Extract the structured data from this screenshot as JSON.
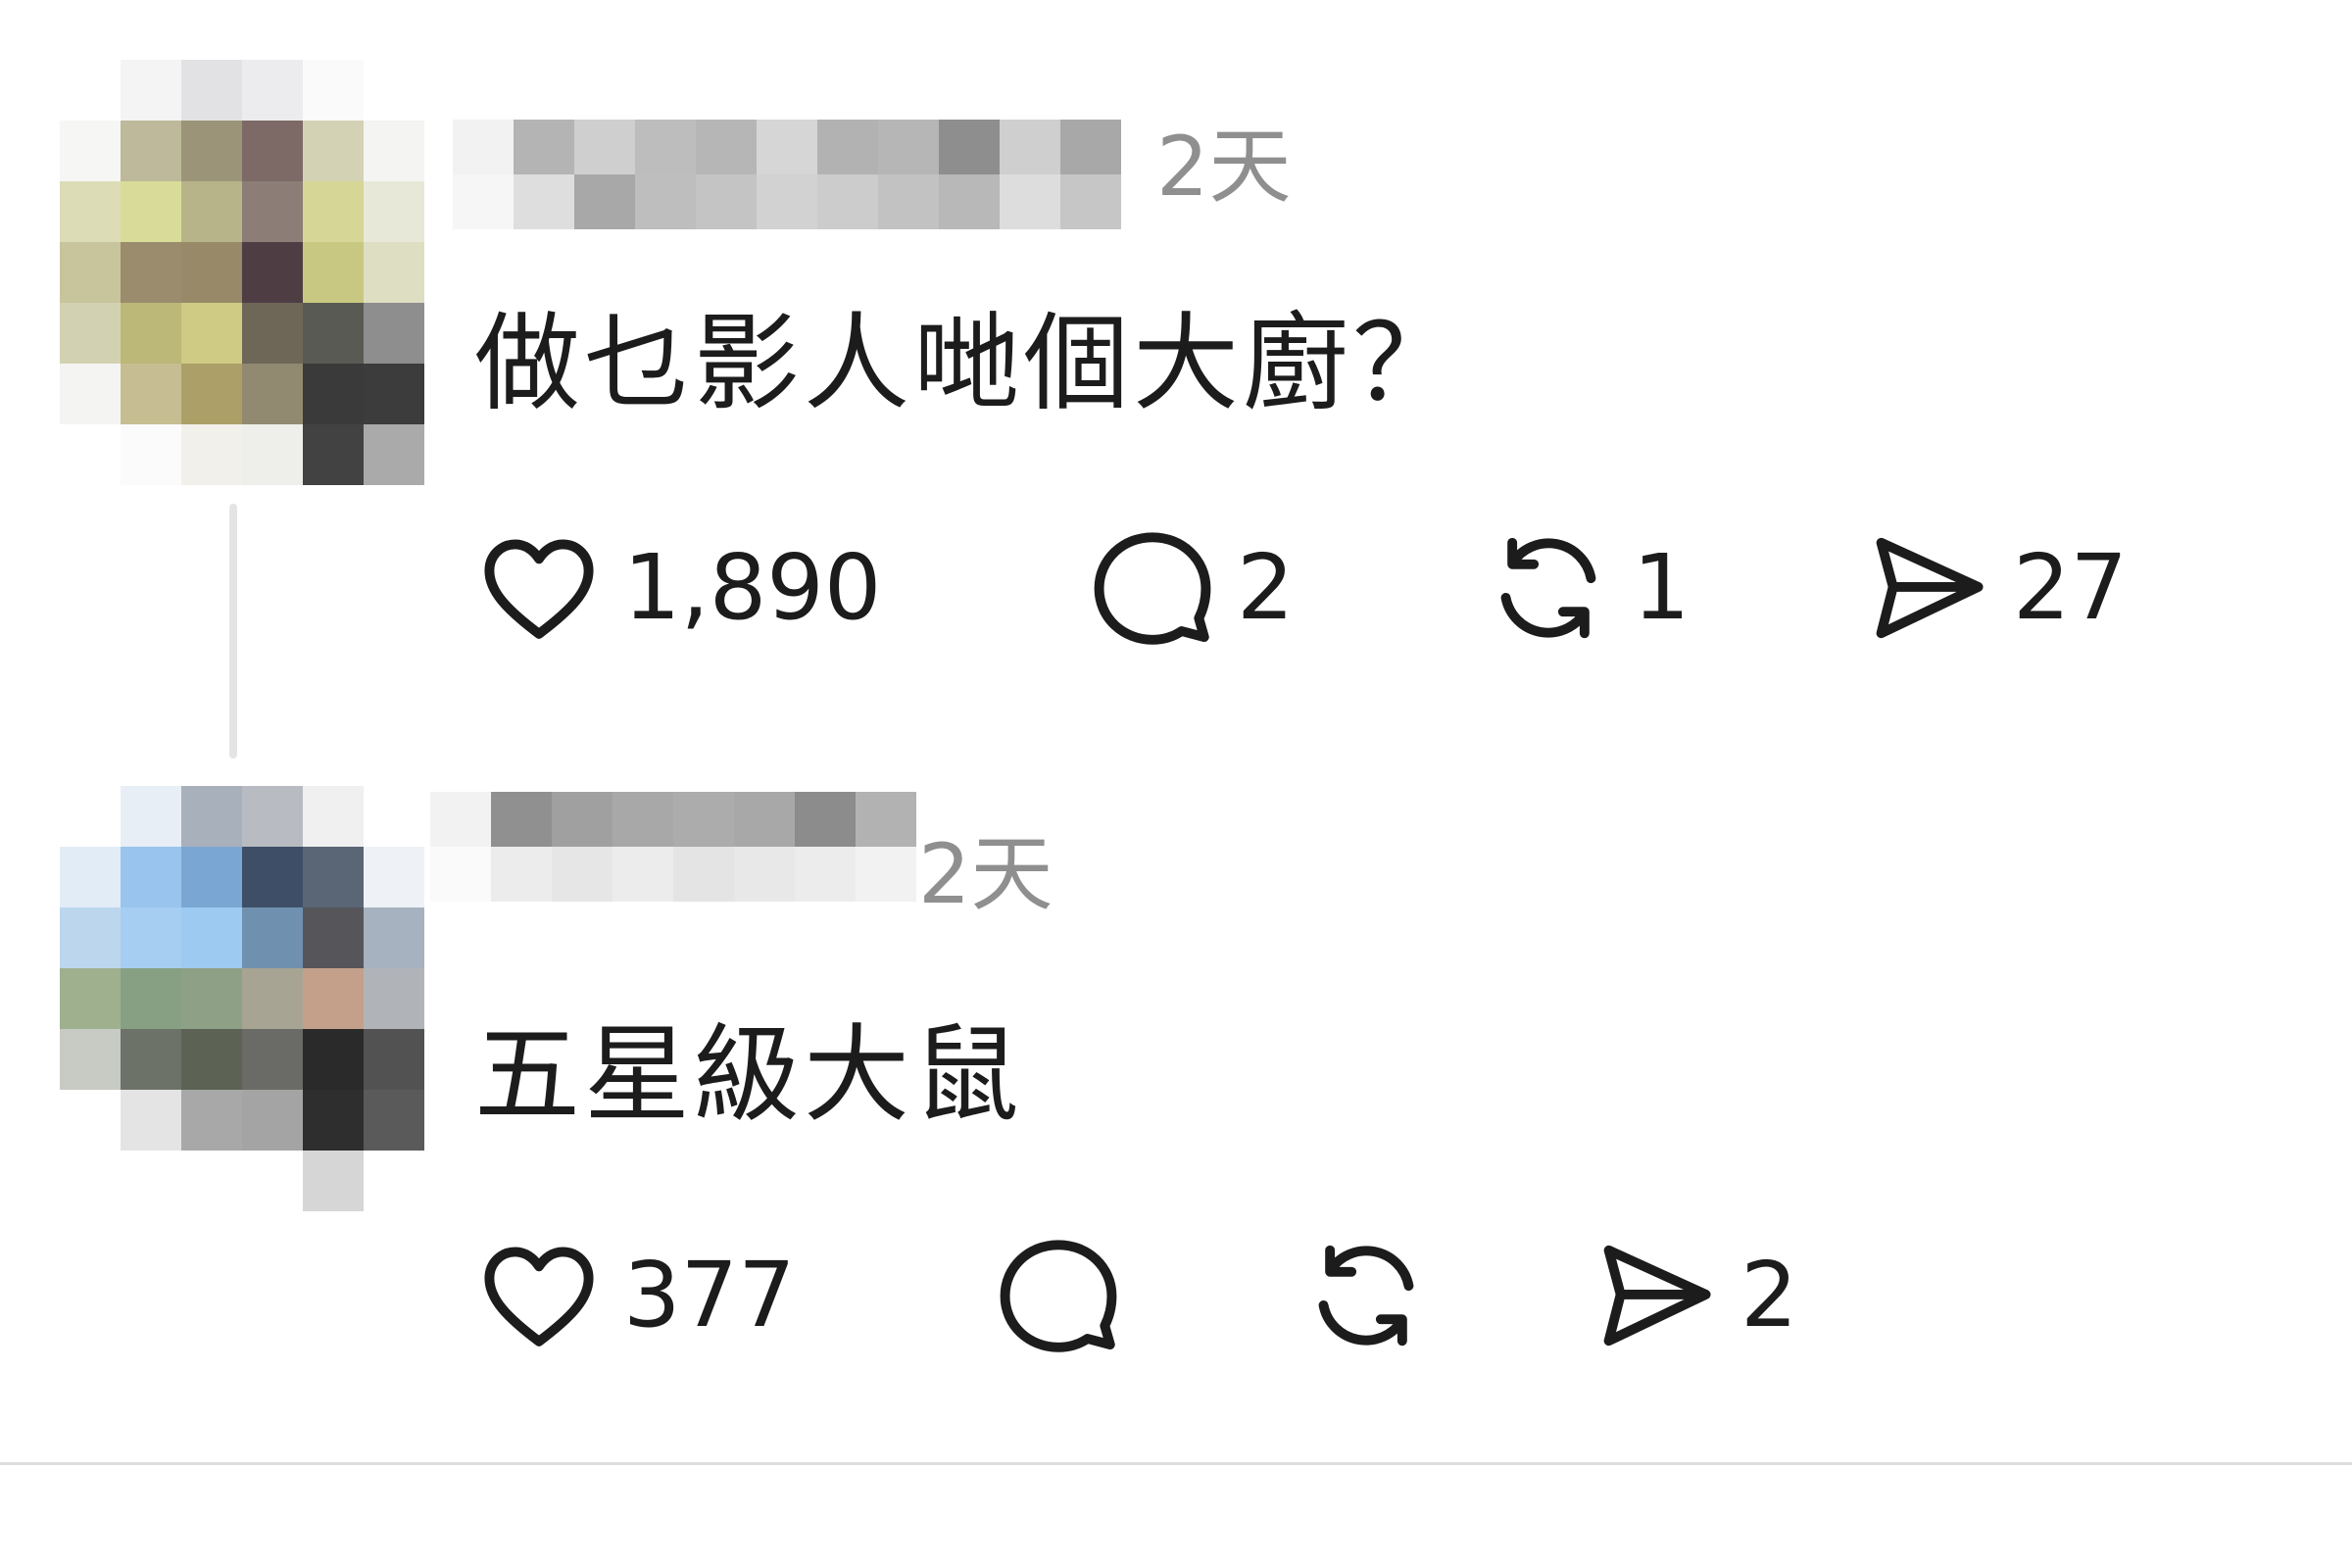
{
  "posts": [
    {
      "timestamp": "2天",
      "content": "做乜影人哋個大廚？",
      "actions": {
        "likes": "1,890",
        "replies": "2",
        "reposts": "1",
        "shares": "27"
      }
    },
    {
      "timestamp": "2天",
      "content": "五星級大鼠",
      "actions": {
        "likes": "377",
        "replies": "",
        "reposts": "",
        "shares": "2"
      }
    }
  ],
  "icons": {
    "like": "heart-icon",
    "reply": "speech-bubble-icon",
    "repost": "repost-icon",
    "share": "send-icon"
  },
  "colors": {
    "text": "#1c1c1c",
    "timestamp": "#8f8f8f",
    "thread_line": "#e4e4e4",
    "divider": "#dcdcdc"
  }
}
